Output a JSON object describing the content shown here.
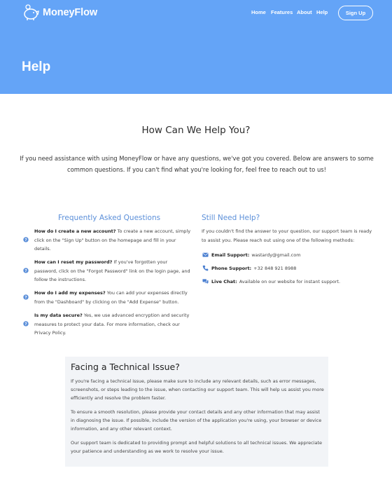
{
  "brand": {
    "name": "MoneyFlow",
    "logo_icon": "piggy-bank-icon"
  },
  "nav": {
    "items": [
      "Home",
      "Features",
      "About",
      "Help"
    ],
    "signup_label": "Sign Up"
  },
  "header": {
    "title": "Help"
  },
  "intro": {
    "title": "How Can We Help You?",
    "text": "If you need assistance with using MoneyFlow or have any questions, we've got you covered. Below are answers to some common questions. If you can't find what you're looking for, feel free to reach out to us!"
  },
  "faq": {
    "title": "Frequently Asked Questions",
    "items": [
      {
        "q": "How do I create a new account?",
        "a": " To create a new account, simply click on the \"Sign Up\" button on the homepage and fill in your details."
      },
      {
        "q": "How can I reset my password?",
        "a": " If you've forgotten your password, click on the \"Forgot Password\" link on the login page, and follow the instructions."
      },
      {
        "q": "How do I add my expenses?",
        "a": " You can add your expenses directly from the \"Dashboard\" by clicking on the \"Add Expense\" button."
      },
      {
        "q": "Is my data secure?",
        "a": " Yes, we use advanced encryption and security measures to protect your data. For more information, check our Privacy Policy."
      }
    ]
  },
  "support": {
    "title": "Still Need Help?",
    "text": "If you couldn't find the answer to your question, our support team is ready to assist you. Please reach out using one of the following methods:",
    "email": {
      "label": "Email Support:",
      "value": "wastardy@gmail.com"
    },
    "phone": {
      "label": "Phone Support:",
      "value": "+32 848 921 8988"
    },
    "chat": {
      "label": "Live Chat:",
      "value": "Available on our website for instant support."
    }
  },
  "tech": {
    "title": "Facing a Technical Issue?",
    "paragraphs": [
      "If you're facing a technical issue, please make sure to include any relevant details, such as error messages, screenshots, or steps leading to the issue, when contacting our support team. This will help us assist you more efficiently and resolve the problem faster.",
      "To ensure a smooth resolution, please provide your contact details and any other information that may assist in diagnosing the issue. If possible, include the version of the application you're using, your browser or device information, and any other relevant context.",
      "Our support team is dedicated to providing prompt and helpful solutions to all technical issues. We appreciate your patience and understanding as we work to resolve your issue."
    ]
  },
  "colors": {
    "header_bg": "#64a4f7",
    "accent": "#5b8fd9",
    "panel_bg": "#f2f4f7"
  }
}
